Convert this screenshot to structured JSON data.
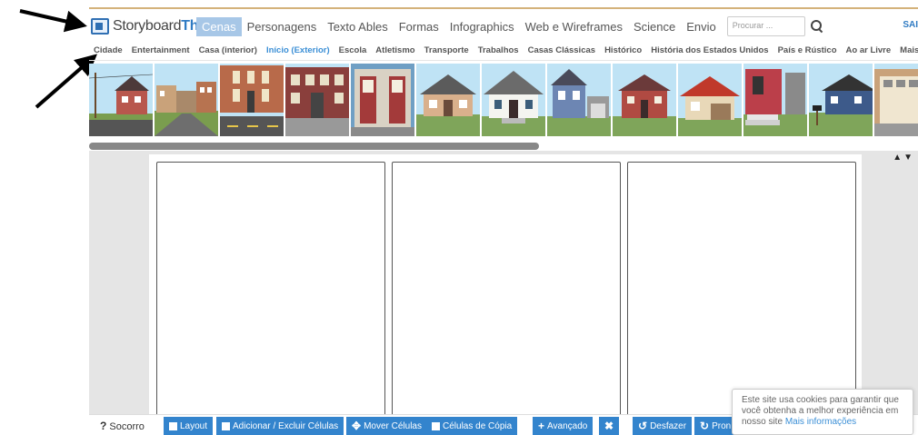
{
  "logo": {
    "part1": "Storyboard",
    "part2": "That"
  },
  "nav": {
    "items": [
      {
        "label": "Cenas",
        "active": true
      },
      {
        "label": "Personagens"
      },
      {
        "label": "Texto Ables"
      },
      {
        "label": "Formas"
      },
      {
        "label": "Infographics"
      },
      {
        "label": "Web e Wireframes"
      },
      {
        "label": "Science"
      },
      {
        "label": "Envio"
      }
    ],
    "search_placeholder": "Procurar ...",
    "sair": "SAI"
  },
  "categories": [
    {
      "label": "Cidade"
    },
    {
      "label": "Entertainment"
    },
    {
      "label": "Casa (interior)"
    },
    {
      "label": "Início (Exterior)",
      "active": true
    },
    {
      "label": "Escola"
    },
    {
      "label": "Atletismo"
    },
    {
      "label": "Transporte"
    },
    {
      "label": "Trabalhos"
    },
    {
      "label": "Casas Clássicas"
    },
    {
      "label": "Histórico"
    },
    {
      "label": "História dos Estados Unidos"
    },
    {
      "label": "País e Rústico"
    },
    {
      "label": "Ao ar Livre"
    },
    {
      "label": "Mais ▾"
    }
  ],
  "scene_thumbnails": [
    {
      "icon": "street-house-scene-icon"
    },
    {
      "icon": "row-houses-scene-icon"
    },
    {
      "icon": "townhouse-street-scene-icon"
    },
    {
      "icon": "brownstone-scene-icon"
    },
    {
      "icon": "front-doors-scene-icon"
    },
    {
      "icon": "bungalow-scene-icon"
    },
    {
      "icon": "white-house-scene-icon"
    },
    {
      "icon": "blue-house-scene-icon"
    },
    {
      "icon": "brick-house-scene-icon"
    },
    {
      "icon": "red-roof-house-scene-icon"
    },
    {
      "icon": "porch-steps-scene-icon"
    },
    {
      "icon": "mailbox-house-scene-icon"
    },
    {
      "icon": "garage-door-scene-icon"
    }
  ],
  "workspace": {
    "scroll_arrows": "▲▼"
  },
  "bottom_bar": {
    "help": "Socorro",
    "help_icon": "?",
    "buttons": [
      {
        "label": "Layout",
        "icon": "layout-icon"
      },
      {
        "label": "Adicionar / Excluir Células",
        "icon": "add-cells-icon"
      },
      {
        "label": "Mover Células",
        "icon": "move-icon"
      },
      {
        "label": "Células de Cópia",
        "icon": "copy-icon"
      },
      {
        "label": "Avançado",
        "icon": "plus-icon"
      },
      {
        "label": "",
        "icon": "fullscreen-icon"
      },
      {
        "label": "Desfazer",
        "icon": "undo-icon"
      },
      {
        "label": "Pron",
        "icon": "redo-icon"
      }
    ]
  },
  "cookie_notice": {
    "text": "Este site usa cookies para garantir que você obtenha a melhor experiência em nosso site",
    "link": "Mais informações"
  },
  "colors": {
    "accent": "#3384cd",
    "active_tab": "#a7c7e7",
    "nav_border": "#d4b27a"
  }
}
